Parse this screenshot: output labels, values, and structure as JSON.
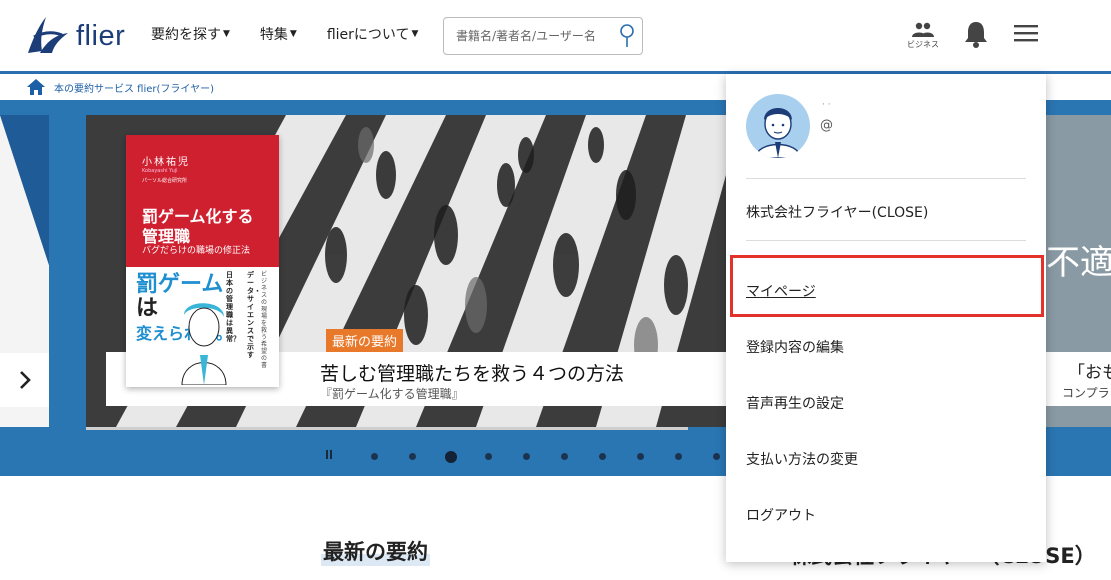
{
  "header": {
    "logo_text": "flier",
    "nav": [
      {
        "label": "要約を探す"
      },
      {
        "label": "特集"
      },
      {
        "label": "flierについて"
      }
    ],
    "search": {
      "placeholder": "書籍名/著者名/ユーザー名"
    },
    "business_label": "ビジネス",
    "icons": [
      "business-users-icon",
      "bell-icon",
      "hamburger-menu-icon"
    ],
    "accent_color": "#2b6fb1"
  },
  "breadcrumb": {
    "text": "本の要約サービス flier(フライヤー)"
  },
  "hero": {
    "badge": "最新の要約",
    "title": "苦しむ管理職たちを救う４つの方法",
    "subtitle": "『罰ゲーム化する管理職』",
    "right_slide_text": "不適",
    "right_caption_title": "「おも",
    "right_caption_sub": "コンプラ",
    "book": {
      "author": "小林祐児",
      "author_romaji": "Kobayashi Yuji",
      "publisher": "パーソル総合研究所",
      "title_line1": "罰ゲーム化する",
      "title_line2": "管理職",
      "subtitle": "バグだらけの職場の修正法",
      "big_1": "罰",
      "big_2": "ゲーム",
      "big_3": "は",
      "big_4": "変えられる。",
      "vertical_1": "日本の管理職は異常？",
      "vertical_2": "データ・サイエンスで示す",
      "vertical_3": "ビジネスの現場を救う希望の書"
    },
    "dots_count": 10,
    "active_dot_index": 2,
    "badge_color": "#e8792b"
  },
  "sections": {
    "latest_title": "最新の要約",
    "right_title": "株式会社フライヤー（CLOSE）"
  },
  "dropdown": {
    "user_name": "· ·",
    "user_handle": "@",
    "company": "株式会社フライヤー(CLOSE)",
    "items": [
      {
        "label": "マイページ"
      },
      {
        "label": "登録内容の編集"
      },
      {
        "label": "音声再生の設定"
      },
      {
        "label": "支払い方法の変更"
      },
      {
        "label": "ログアウト"
      }
    ],
    "highlight_color": "#e2322a"
  }
}
